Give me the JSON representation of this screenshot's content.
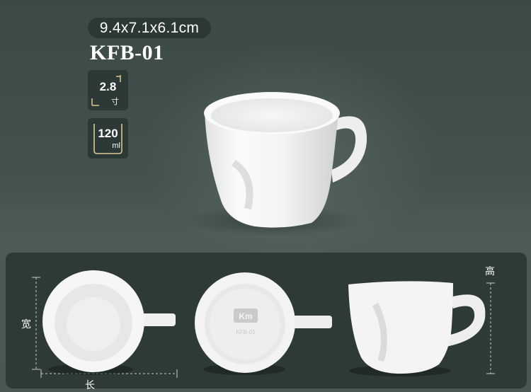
{
  "header": {
    "dimensions": "9.4x7.1x6.1cm",
    "model": "KFB-01"
  },
  "badges": {
    "size": {
      "value": "2.8",
      "unit": "寸"
    },
    "volume": {
      "value": "120",
      "unit": "ml"
    }
  },
  "views": {
    "width_label": "宽",
    "length_label": "长",
    "height_label": "高",
    "bottom_stamp_text": "KFB-01"
  },
  "colors": {
    "background": "#44524f",
    "panel": "#2d3a38",
    "pill": "#2b3836",
    "text": "#ffffff",
    "porcelain": "#f4f4f2"
  }
}
